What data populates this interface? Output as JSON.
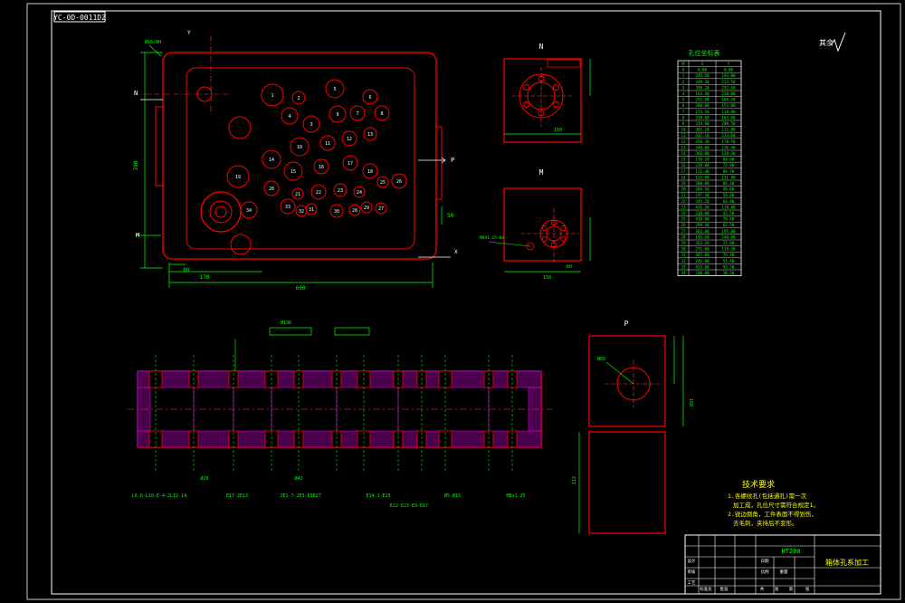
{
  "drawing_number": "YC-0D-0011DZ",
  "roughness_mark": "其余",
  "view_labels": {
    "top": "N",
    "middle": "M",
    "right": "P"
  },
  "axis_labels": {
    "y": "Y",
    "x": "X",
    "n_arrow": "N",
    "p_arrow": "P",
    "m_arrow": "M"
  },
  "main_dimensions": {
    "width": "600",
    "height": "390",
    "offset_a": "170",
    "offset_b": "80",
    "small": "50"
  },
  "side_dimensions": {
    "n_width": "150",
    "m_width": "150",
    "m_depth": "60",
    "p_height": "160",
    "p_width": "112"
  },
  "hole_labels": [
    "1",
    "2",
    "3",
    "4",
    "5",
    "6",
    "7",
    "8",
    "9",
    "10",
    "11",
    "12",
    "13",
    "14",
    "15",
    "16",
    "17",
    "18",
    "19",
    "20",
    "21",
    "22",
    "23",
    "24",
    "25",
    "26",
    "27",
    "28",
    "29",
    "30",
    "31",
    "32",
    "33",
    "34"
  ],
  "coord_table": {
    "title": "孔位坐标表",
    "headers": [
      "序",
      "X",
      "Y"
    ],
    "rows": [
      [
        "O",
        "0.00",
        "0.00"
      ],
      [
        "1",
        "245.50",
        "193.80"
      ],
      [
        "2",
        "349.30",
        "233.50"
      ],
      [
        "3",
        "390.20",
        "252.50"
      ],
      [
        "4",
        "163.40",
        "220.00"
      ],
      [
        "5",
        "251.00",
        "186.50"
      ],
      [
        "6",
        "300.00",
        "151.80"
      ],
      [
        "7",
        "273.50",
        "110.90"
      ],
      [
        "8",
        "338.60",
        "163.00"
      ],
      [
        "9",
        "314.60",
        "208.50"
      ],
      [
        "10",
        "382.20",
        "112.80"
      ],
      [
        "11",
        "417.10",
        "213.60"
      ],
      [
        "12",
        "450.30",
        "178.50"
      ],
      [
        "13",
        "340.00",
        "136.40"
      ],
      [
        "14",
        "366.00",
        "128.30"
      ],
      [
        "15",
        "176.20",
        "94.00"
      ],
      [
        "16",
        "239.00",
        "72.00"
      ],
      [
        "17",
        "111.40",
        "89.70"
      ],
      [
        "18",
        "122.80",
        "131.80"
      ],
      [
        "19",
        "380.80",
        "88.40"
      ],
      [
        "20",
        "284.50",
        "90.00"
      ],
      [
        "21",
        "197.40",
        "58.00"
      ],
      [
        "22",
        "345.20",
        "64.80"
      ],
      [
        "23",
        "421.50",
        "110.80"
      ],
      [
        "24",
        "218.00",
        "43.50"
      ],
      [
        "25",
        "410.00",
        "79.40"
      ],
      [
        "26",
        "299.30",
        "62.50"
      ],
      [
        "27",
        "302.00",
        "195.00"
      ],
      [
        "28",
        "195.60",
        "140.60"
      ],
      [
        "29",
        "263.20",
        "27.00"
      ],
      [
        "30",
        "271.00",
        "119.30"
      ],
      [
        "31",
        "367.00",
        "79.40"
      ],
      [
        "32",
        "241.80",
        "51.40"
      ],
      [
        "33",
        "453.00",
        "93.50"
      ],
      [
        "34",
        "298.00",
        "38.50"
      ]
    ]
  },
  "section_dims": [
    "Ø138",
    "L6.6-L10-E-4-2L12-14",
    "E17-2E13",
    "2E1-7-2E3-E3E27",
    "E14.1-E15",
    "E22-E23-E3-E17",
    "Ø5 Ø15",
    "M8x1.25",
    "Ø20",
    "Ø42"
  ],
  "tech_notes": {
    "title": "技术要求",
    "lines": [
      "1.各螺纹孔(包括通孔)需一次",
      "加工成，孔位尺寸需符合规定1。",
      "2.锐边倒角，工件表面不得划伤，",
      "去毛刺，夹持后不变形。"
    ]
  },
  "title_block": {
    "part_name": "箱体孔系加工",
    "material": "HT200",
    "labels": [
      "设计",
      "审核",
      "工艺",
      "标准化",
      "批准",
      "日期",
      "比例",
      "重量",
      "共",
      "张",
      "第",
      "张"
    ]
  },
  "colors": {
    "background": "#000000",
    "part_outline": "#ff0000",
    "dimension": "#00ff00",
    "hatch": "#ff00ff",
    "center_line": "#ff3333",
    "frame": "#ffffff",
    "text": "#ffffff",
    "highlight": "#ffff00"
  }
}
